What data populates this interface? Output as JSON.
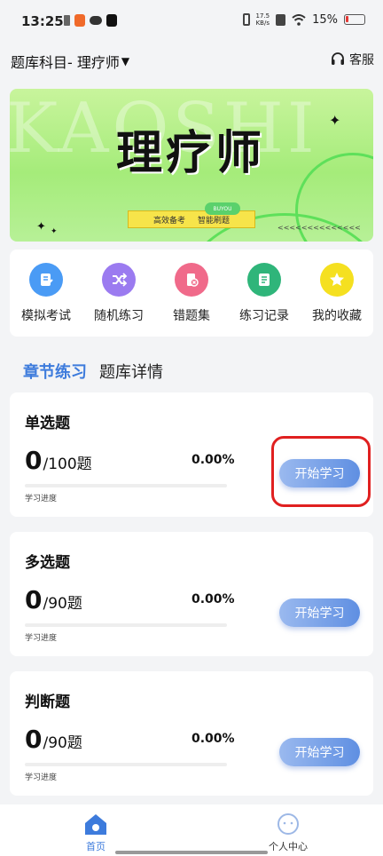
{
  "status_bar": {
    "time": "13:25",
    "net_speed_value": "17.5",
    "net_speed_unit": "KB/s",
    "battery": "15%"
  },
  "header": {
    "subject_title": "题库科目- 理疗师",
    "subject_caret": "▼",
    "service_label": "客服"
  },
  "banner": {
    "bg_text": "KAOSHI",
    "title": "理疗师",
    "tag_left": "高效备考",
    "tag_right": "智能刷题",
    "badge": "BUYOU",
    "arrows": "<<<<<<<<<<<<<<"
  },
  "quick_menu": [
    {
      "label": "模拟考试",
      "icon": "exam-icon",
      "color": "#4a9bf5"
    },
    {
      "label": "随机练习",
      "icon": "shuffle-icon",
      "color": "#9b7bf0"
    },
    {
      "label": "错题集",
      "icon": "wrong-questions-icon",
      "color": "#f06a8a"
    },
    {
      "label": "练习记录",
      "icon": "record-icon",
      "color": "#2fb57a"
    },
    {
      "label": "我的收藏",
      "icon": "star-icon",
      "color": "#f5e020"
    }
  ],
  "tabs": [
    {
      "label": "章节练习",
      "active": true
    },
    {
      "label": "题库详情",
      "active": false
    }
  ],
  "cards": [
    {
      "title": "单选题",
      "done": "0",
      "total": "/100题",
      "percent": "0.00%",
      "progress": 0,
      "progress_label": "学习进度",
      "button": "开始学习"
    },
    {
      "title": "多选题",
      "done": "0",
      "total": "/90题",
      "percent": "0.00%",
      "progress": 0,
      "progress_label": "学习进度",
      "button": "开始学习"
    },
    {
      "title": "判断题",
      "done": "0",
      "total": "/90题",
      "percent": "0.00%",
      "progress": 0,
      "progress_label": "学习进度",
      "button": "开始学习"
    }
  ],
  "bottom_nav": {
    "home": "首页",
    "me": "个人中心"
  },
  "colors": {
    "accent": "#3d7bdc",
    "highlight": "#e02020"
  }
}
